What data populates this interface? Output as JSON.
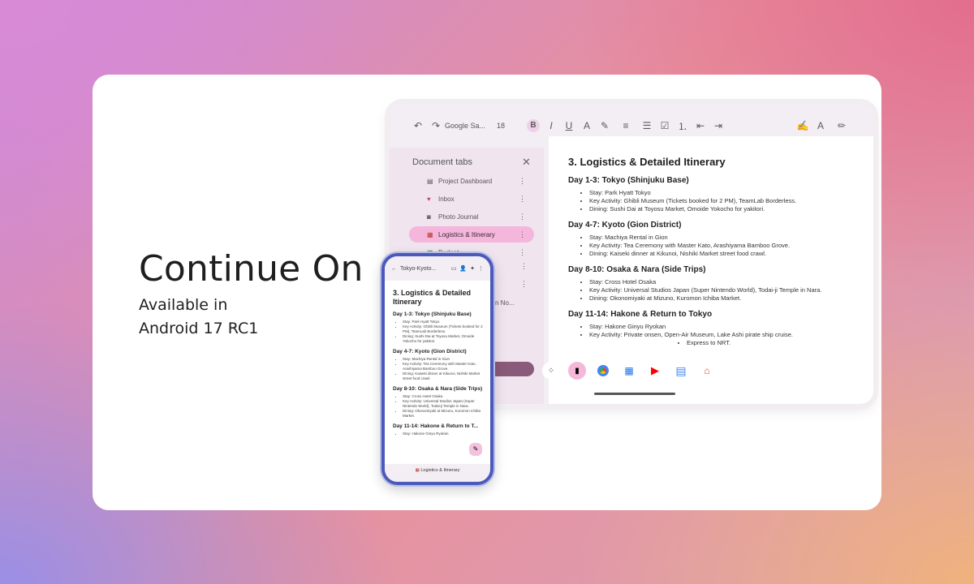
{
  "hero": {
    "headline": "Continue On",
    "sub_line1": "Available in",
    "sub_line2": "Android 17 RC1"
  },
  "toolbar": {
    "font": "Google Sa...",
    "size": "18",
    "bold": "B",
    "italic": "I",
    "underline": "U",
    "text_color": "A"
  },
  "side_panel": {
    "title": "Document tabs",
    "items": [
      {
        "icon": "▤",
        "label": "Project Dashboard"
      },
      {
        "icon": "♥",
        "label": "Inbox"
      },
      {
        "icon": "◙",
        "label": "Photo Journal"
      },
      {
        "icon": "▦",
        "label": "Logistics & Itinerary"
      },
      {
        "icon": "▩",
        "label": "Budget"
      }
    ],
    "truncated_item": "n No..."
  },
  "document": {
    "title": "3. Logistics & Detailed Itinerary",
    "sections": [
      {
        "heading": "Day 1-3: Tokyo (Shinjuku Base)",
        "bullets": [
          "Stay: Park Hyatt Tokyo",
          "Key Activity: Ghibli Museum (Tickets booked for 2 PM), TeamLab Borderless.",
          "Dining: Sushi Dai at Toyosu Market, Omoide Yokocho for yakitori."
        ]
      },
      {
        "heading": "Day 4-7: Kyoto (Gion District)",
        "bullets": [
          "Stay: Machiya Rental in Gion",
          "Key Activity: Tea Ceremony with Master Kato, Arashiyama Bamboo Grove.",
          "Dining: Kaiseki dinner at Kikunoi, Nishiki Market street food crawl."
        ]
      },
      {
        "heading": "Day 8-10: Osaka & Nara (Side Trips)",
        "bullets": [
          "Stay: Cross Hotel Osaka",
          "Key Activity: Universal Studios Japan (Super Nintendo World), Todai-ji Temple in Nara.",
          "Dining: Okonomiyaki at Mizuno, Kuromon Ichiba Market."
        ]
      },
      {
        "heading": "Day 11-14: Hakone & Return to Tokyo",
        "bullets": [
          "Stay: Hakone Ginyu Ryokan",
          "Key Activity: Private onsen, Open-Air Museum, Lake Ashi pirate ship cruise.",
          "Express to NRT."
        ]
      }
    ]
  },
  "phone": {
    "tab_title": "Tokyo-Kyoto...",
    "doc_title": "3. Logistics & Detailed Itinerary",
    "sections": [
      {
        "heading": "Day 1-3: Tokyo (Shinjuku Base)",
        "bullets": [
          "Stay: Park Hyatt Tokyo",
          "Key Activity: Ghibli Museum (Tickets booked for 2 PM), TeamLab Borderless.",
          "Dining: Sushi Dai at Toyosu Market, Omoide Yokocho for yakitori."
        ]
      },
      {
        "heading": "Day 4-7: Kyoto (Gion District)",
        "bullets": [
          "Stay: Machiya Rental in Gion",
          "Key Activity: Tea Ceremony with Master Kato, Arashiyama Bamboo Grove.",
          "Dining: Kaiseki dinner at Kikunoi, Nishiki Market street food crawl."
        ]
      },
      {
        "heading": "Day 8-10: Osaka & Nara (Side Trips)",
        "bullets": [
          "Stay: Cross Hotel Osaka",
          "Key Activity: Universal Studios Japan (Super Nintendo World), Todai-ji Temple in Nara.",
          "Dining: Okonomiyaki at Mizuno, Kuromon Ichiba Market."
        ]
      },
      {
        "heading": "Day 11-14: Hakone & Return to T...",
        "bullets": [
          "Stay: Hakone Ginyu Ryokan"
        ]
      }
    ],
    "bottom_tab": "Logistics & Itinerary"
  },
  "colors": {
    "accent_pink": "#f5b6dc",
    "phone_frame": "#4c59b8"
  }
}
